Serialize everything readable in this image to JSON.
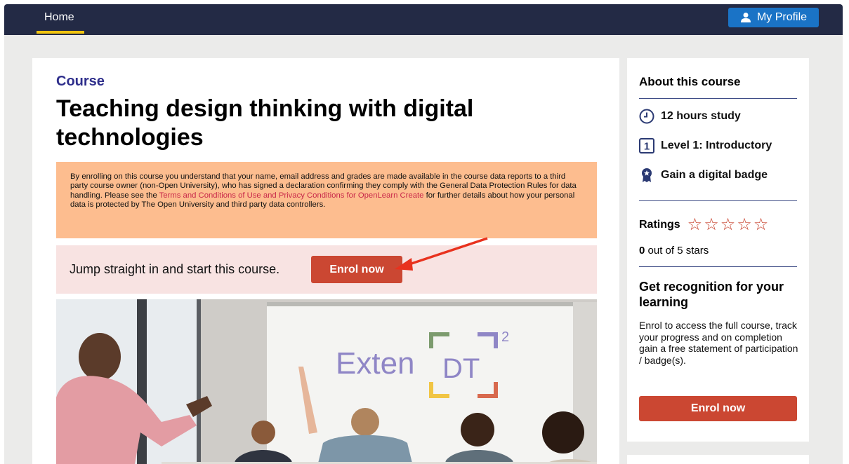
{
  "nav": {
    "home_label": "Home",
    "profile_label": "My Profile"
  },
  "course": {
    "label": "Course",
    "title": "Teaching design thinking with digital technologies"
  },
  "notice": {
    "text_before": "By enrolling on this course you understand that your name, email address and grades are made available in the course data reports to a third party course owner (non-Open University), who has signed a declaration confirming they comply with the General Data Protection Rules for data handling. Please see the ",
    "link_text": "Terms and Conditions of Use and Privacy Conditions for OpenLearn Create",
    "text_after": " for further details about how your personal data is protected by The Open University and third party data controllers."
  },
  "jump": {
    "text": "Jump straight in and start this course.",
    "button": "Enrol now"
  },
  "hero": {
    "board_text": "Exten",
    "logo_text": "DT",
    "logo_sup": "2"
  },
  "sidebar": {
    "about_title": "About this course",
    "facts": [
      {
        "icon": "clock-icon",
        "label": "12 hours study"
      },
      {
        "icon": "level-icon",
        "level": "1",
        "label": "Level 1: Introductory"
      },
      {
        "icon": "badge-icon",
        "label": "Gain a digital badge"
      }
    ],
    "ratings_label": "Ratings",
    "rating_value": 0,
    "rating_max": 5,
    "score_value": "0",
    "score_suffix": " out of 5 stars",
    "recognition_title": "Get recognition for your learning",
    "recognition_text": "Enrol to access the full course, track your progress and on completion gain a free statement of participation / badge(s).",
    "enrol_button": "Enrol now"
  },
  "colors": {
    "nav_bg": "#232a45",
    "accent_yellow": "#f1c40f",
    "profile_blue": "#1a73c6",
    "enrol_red": "#cb4732",
    "course_label": "#2f2f8c",
    "notice_bg": "#fdbd8f",
    "jump_bg": "#f8e3e2"
  }
}
